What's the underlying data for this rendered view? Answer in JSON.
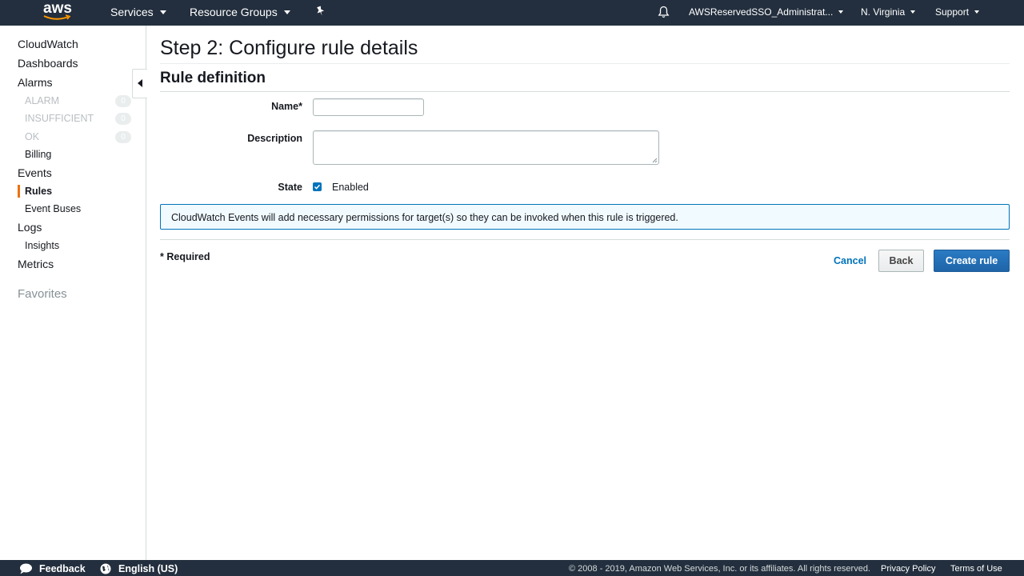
{
  "topnav": {
    "logo_text": "aws",
    "services_label": "Services",
    "resource_groups_label": "Resource Groups",
    "account_label": "AWSReservedSSO_Administrat...",
    "region_label": "N. Virginia",
    "support_label": "Support",
    "icons": [
      "pin-icon",
      "bell-icon"
    ]
  },
  "sidebar": {
    "cloudwatch": "CloudWatch",
    "dashboards": "Dashboards",
    "alarms": "Alarms",
    "alarm_states": [
      {
        "label": "ALARM",
        "count": "0"
      },
      {
        "label": "INSUFFICIENT",
        "count": "0"
      },
      {
        "label": "OK",
        "count": "0"
      }
    ],
    "billing": "Billing",
    "events": "Events",
    "rules": "Rules",
    "event_buses": "Event Buses",
    "logs": "Logs",
    "insights": "Insights",
    "metrics": "Metrics",
    "favorites": "Favorites",
    "accent_color": "#ec7211"
  },
  "main": {
    "title": "Step 2: Configure rule details",
    "section_title": "Rule definition",
    "name_label": "Name*",
    "name_value": "",
    "description_label": "Description",
    "description_value": "",
    "state_label": "State",
    "enabled_label": "Enabled",
    "enabled_checked": true,
    "info_message": "CloudWatch Events will add necessary permissions for target(s) so they can be invoked when this rule is triggered.",
    "required_note": "* Required",
    "cancel_label": "Cancel",
    "back_label": "Back",
    "create_label": "Create rule",
    "primary_color": "#1f64a8"
  },
  "footer": {
    "feedback_label": "Feedback",
    "language_label": "English (US)",
    "copyright": "© 2008 - 2019, Amazon Web Services, Inc. or its affiliates. All rights reserved.",
    "privacy_label": "Privacy Policy",
    "terms_label": "Terms of Use"
  }
}
